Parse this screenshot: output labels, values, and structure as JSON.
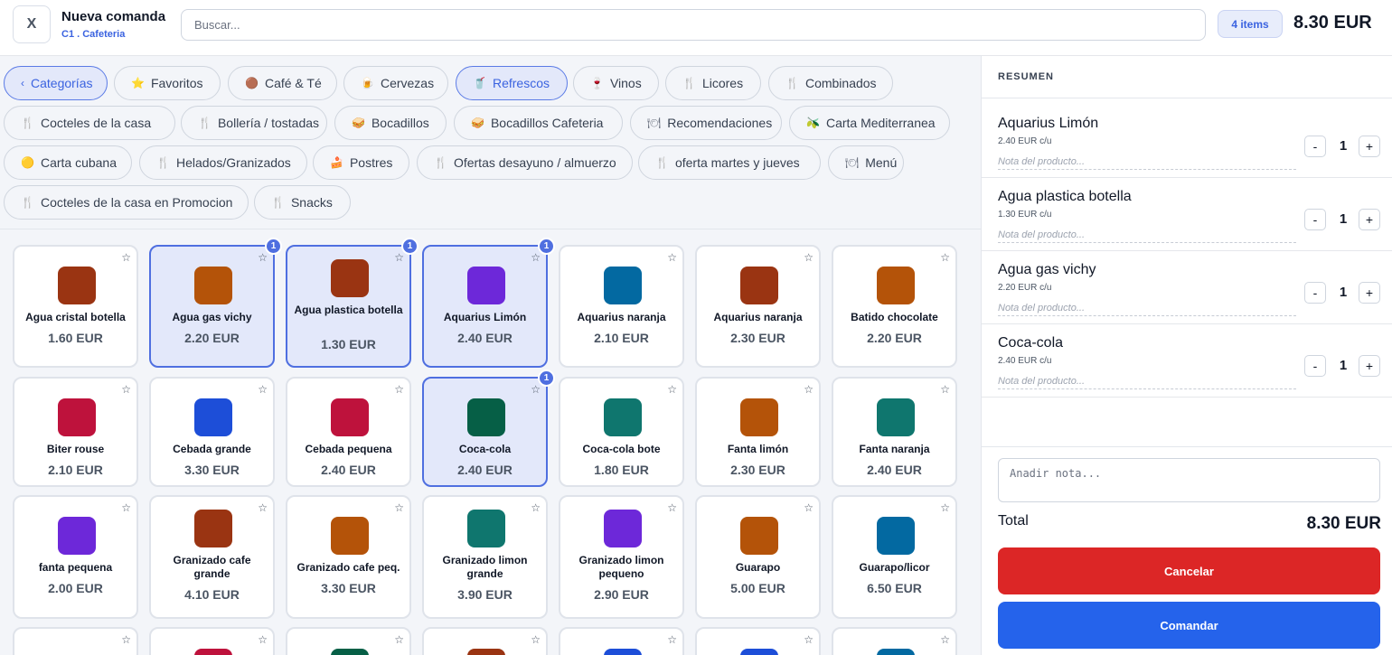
{
  "header": {
    "close_label": "X",
    "title": "Nueva comanda",
    "subtitle": "C1 . Cafeteria",
    "search_placeholder": "Buscar...",
    "items_count": "4 items",
    "total": "8.30 EUR"
  },
  "categories": [
    {
      "label": "Categorías",
      "icon": "chevron-left-icon",
      "glyph": "‹",
      "active": true
    },
    {
      "label": "Favoritos",
      "icon": "star-icon",
      "glyph": "⭐",
      "active": false
    },
    {
      "label": "Café & Té",
      "icon": "coffee-icon",
      "glyph": "🟤",
      "active": false
    },
    {
      "label": "Cervezas",
      "icon": "beer-icon",
      "glyph": "🍺",
      "active": false
    },
    {
      "label": "Refrescos",
      "icon": "soda-icon",
      "glyph": "🥤",
      "active": true
    },
    {
      "label": "Vinos",
      "icon": "wine-icon",
      "glyph": "🍷",
      "active": false
    },
    {
      "label": "Licores",
      "icon": "fork-knife-icon",
      "glyph": "🍴",
      "active": false
    },
    {
      "label": "Combinados",
      "icon": "fork-knife-icon",
      "glyph": "🍴",
      "active": false
    },
    {
      "label": "Cocteles de la casa",
      "icon": "fork-knife-icon",
      "glyph": "🍴",
      "active": false
    },
    {
      "label": "Bollería / tostadas",
      "icon": "fork-knife-icon",
      "glyph": "🍴",
      "active": false
    },
    {
      "label": "Bocadillos",
      "icon": "sandwich-icon",
      "glyph": "🥪",
      "active": false
    },
    {
      "label": "Bocadillos Cafeteria",
      "icon": "sandwich-icon",
      "glyph": "🥪",
      "active": false
    },
    {
      "label": "Recomendaciones",
      "icon": "dish-icon",
      "glyph": "🍽",
      "active": false
    },
    {
      "label": "Carta Mediterranea",
      "icon": "olive-icon",
      "glyph": "🫒",
      "active": false
    },
    {
      "label": "Carta cubana",
      "icon": "cuba-icon",
      "glyph": "🟡",
      "active": false
    },
    {
      "label": "Helados/Granizados",
      "icon": "fork-knife-icon",
      "glyph": "🍴",
      "active": false
    },
    {
      "label": "Postres",
      "icon": "cake-icon",
      "glyph": "🍰",
      "active": false
    },
    {
      "label": "Ofertas desayuno / almuerzo",
      "icon": "fork-knife-icon",
      "glyph": "🍴",
      "active": false
    },
    {
      "label": "oferta martes y jueves",
      "icon": "fork-knife-icon",
      "glyph": "🍴",
      "active": false
    },
    {
      "label": "Menú",
      "icon": "dish-icon",
      "glyph": "🍽",
      "active": false
    },
    {
      "label": "Cocteles de la casa en Promocion",
      "icon": "fork-knife-icon",
      "glyph": "🍴",
      "active": false
    },
    {
      "label": "Snacks",
      "icon": "fork-knife-icon",
      "glyph": "🍴",
      "active": false
    }
  ],
  "products": [
    {
      "name": "Agua cristal botella",
      "price": "1.60 EUR",
      "color": "#9a3412",
      "selected": false,
      "qty": ""
    },
    {
      "name": "Agua gas vichy",
      "price": "2.20 EUR",
      "color": "#b45309",
      "selected": true,
      "qty": "1"
    },
    {
      "name": "Agua plastica botella",
      "price": "1.30 EUR",
      "color": "#9a3412",
      "selected": true,
      "qty": "1"
    },
    {
      "name": "Aquarius Limón",
      "price": "2.40 EUR",
      "color": "#6d28d9",
      "selected": true,
      "qty": "1"
    },
    {
      "name": "Aquarius naranja",
      "price": "2.10 EUR",
      "color": "#0369a1",
      "selected": false,
      "qty": ""
    },
    {
      "name": "Aquarius naranja",
      "price": "2.30 EUR",
      "color": "#9a3412",
      "selected": false,
      "qty": ""
    },
    {
      "name": "Batido chocolate",
      "price": "2.20 EUR",
      "color": "#b45309",
      "selected": false,
      "qty": ""
    },
    {
      "name": "Biter rouse",
      "price": "2.10 EUR",
      "color": "#be123c",
      "selected": false,
      "qty": ""
    },
    {
      "name": "Cebada grande",
      "price": "3.30 EUR",
      "color": "#1d4ed8",
      "selected": false,
      "qty": ""
    },
    {
      "name": "Cebada pequena",
      "price": "2.40 EUR",
      "color": "#be123c",
      "selected": false,
      "qty": ""
    },
    {
      "name": "Coca-cola",
      "price": "2.40 EUR",
      "color": "#065f46",
      "selected": true,
      "qty": "1"
    },
    {
      "name": "Coca-cola bote",
      "price": "1.80 EUR",
      "color": "#0f766e",
      "selected": false,
      "qty": ""
    },
    {
      "name": "Fanta limón",
      "price": "2.30 EUR",
      "color": "#b45309",
      "selected": false,
      "qty": ""
    },
    {
      "name": "Fanta naranja",
      "price": "2.40 EUR",
      "color": "#0f766e",
      "selected": false,
      "qty": ""
    },
    {
      "name": "fanta pequena",
      "price": "2.00 EUR",
      "color": "#6d28d9",
      "selected": false,
      "qty": ""
    },
    {
      "name": "Granizado cafe grande",
      "price": "4.10 EUR",
      "color": "#9a3412",
      "selected": false,
      "qty": ""
    },
    {
      "name": "Granizado cafe peq.",
      "price": "3.30 EUR",
      "color": "#b45309",
      "selected": false,
      "qty": ""
    },
    {
      "name": "Granizado limon grande",
      "price": "3.90 EUR",
      "color": "#0f766e",
      "selected": false,
      "qty": ""
    },
    {
      "name": "Granizado limon pequeno",
      "price": "2.90 EUR",
      "color": "#6d28d9",
      "selected": false,
      "qty": ""
    },
    {
      "name": "Guarapo",
      "price": "5.00 EUR",
      "color": "#b45309",
      "selected": false,
      "qty": ""
    },
    {
      "name": "Guarapo/licor",
      "price": "6.50 EUR",
      "color": "#0369a1",
      "selected": false,
      "qty": ""
    },
    {
      "name": "",
      "price": "",
      "color": "#ffffff",
      "selected": false,
      "qty": ""
    },
    {
      "name": "",
      "price": "",
      "color": "#be123c",
      "selected": false,
      "qty": ""
    },
    {
      "name": "",
      "price": "",
      "color": "#065f46",
      "selected": false,
      "qty": ""
    },
    {
      "name": "",
      "price": "",
      "color": "#9a3412",
      "selected": false,
      "qty": ""
    },
    {
      "name": "",
      "price": "",
      "color": "#1d4ed8",
      "selected": false,
      "qty": ""
    },
    {
      "name": "",
      "price": "",
      "color": "#1d4ed8",
      "selected": false,
      "qty": ""
    },
    {
      "name": "",
      "price": "",
      "color": "#0369a1",
      "selected": false,
      "qty": ""
    }
  ],
  "summary": {
    "heading": "RESUMEN",
    "note_placeholder": "Nota del producto...",
    "items": [
      {
        "name": "Aquarius Limón",
        "unit": "2.40 EUR c/u",
        "qty": "1"
      },
      {
        "name": "Agua plastica botella",
        "unit": "1.30 EUR c/u",
        "qty": "1"
      },
      {
        "name": "Agua gas vichy",
        "unit": "2.20 EUR c/u",
        "qty": "1"
      },
      {
        "name": "Coca-cola",
        "unit": "2.40 EUR c/u",
        "qty": "1"
      }
    ],
    "minus_label": "-",
    "plus_label": "+",
    "order_note_placeholder": "Anadir nota...",
    "total_label": "Total",
    "total_value": "8.30 EUR",
    "cancel_label": "Cancelar",
    "submit_label": "Comandar"
  }
}
